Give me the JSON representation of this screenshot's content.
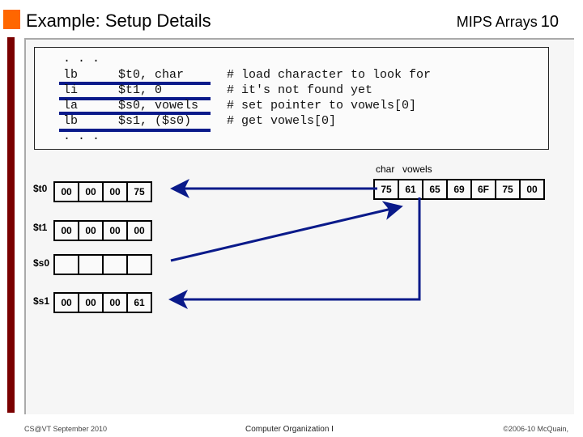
{
  "header": {
    "title": "Example: Setup Details",
    "subtitle": "MIPS Arrays",
    "page_number": "10"
  },
  "code": {
    "lines": [
      {
        "op": ". . .",
        "args": "",
        "comment": ""
      },
      {
        "op": "lb",
        "args": "$t0, char",
        "comment": "# load character to look for"
      },
      {
        "op": "li",
        "args": "$t1, 0",
        "comment": "# it's not found yet"
      },
      {
        "op": "la",
        "args": "$s0, vowels",
        "comment": "# set pointer to vowels[0]"
      },
      {
        "op": "lb",
        "args": "$s1, ($s0)",
        "comment": "# get vowels[0]"
      },
      {
        "op": ". . .",
        "args": "",
        "comment": ""
      }
    ]
  },
  "registers": [
    {
      "name": "$t0",
      "bytes": [
        "00",
        "00",
        "00",
        "75"
      ]
    },
    {
      "name": "$t1",
      "bytes": [
        "00",
        "00",
        "00",
        "00"
      ]
    },
    {
      "name": "$s0",
      "bytes": [
        "",
        "",
        "",
        ""
      ]
    },
    {
      "name": "$s1",
      "bytes": [
        "00",
        "00",
        "00",
        "61"
      ]
    }
  ],
  "memory": {
    "labels": [
      "char",
      "vowels"
    ],
    "bytes": [
      "75",
      "61",
      "65",
      "69",
      "6F",
      "75",
      "00"
    ]
  },
  "colors": {
    "accent_orange": "#ff6600",
    "side_bar": "#7a0000",
    "arrow_blue": "#0a1a8a"
  },
  "footer": {
    "left": "CS@VT September 2010",
    "center": "Computer Organization I",
    "right": "©2006-10  McQuain,"
  }
}
